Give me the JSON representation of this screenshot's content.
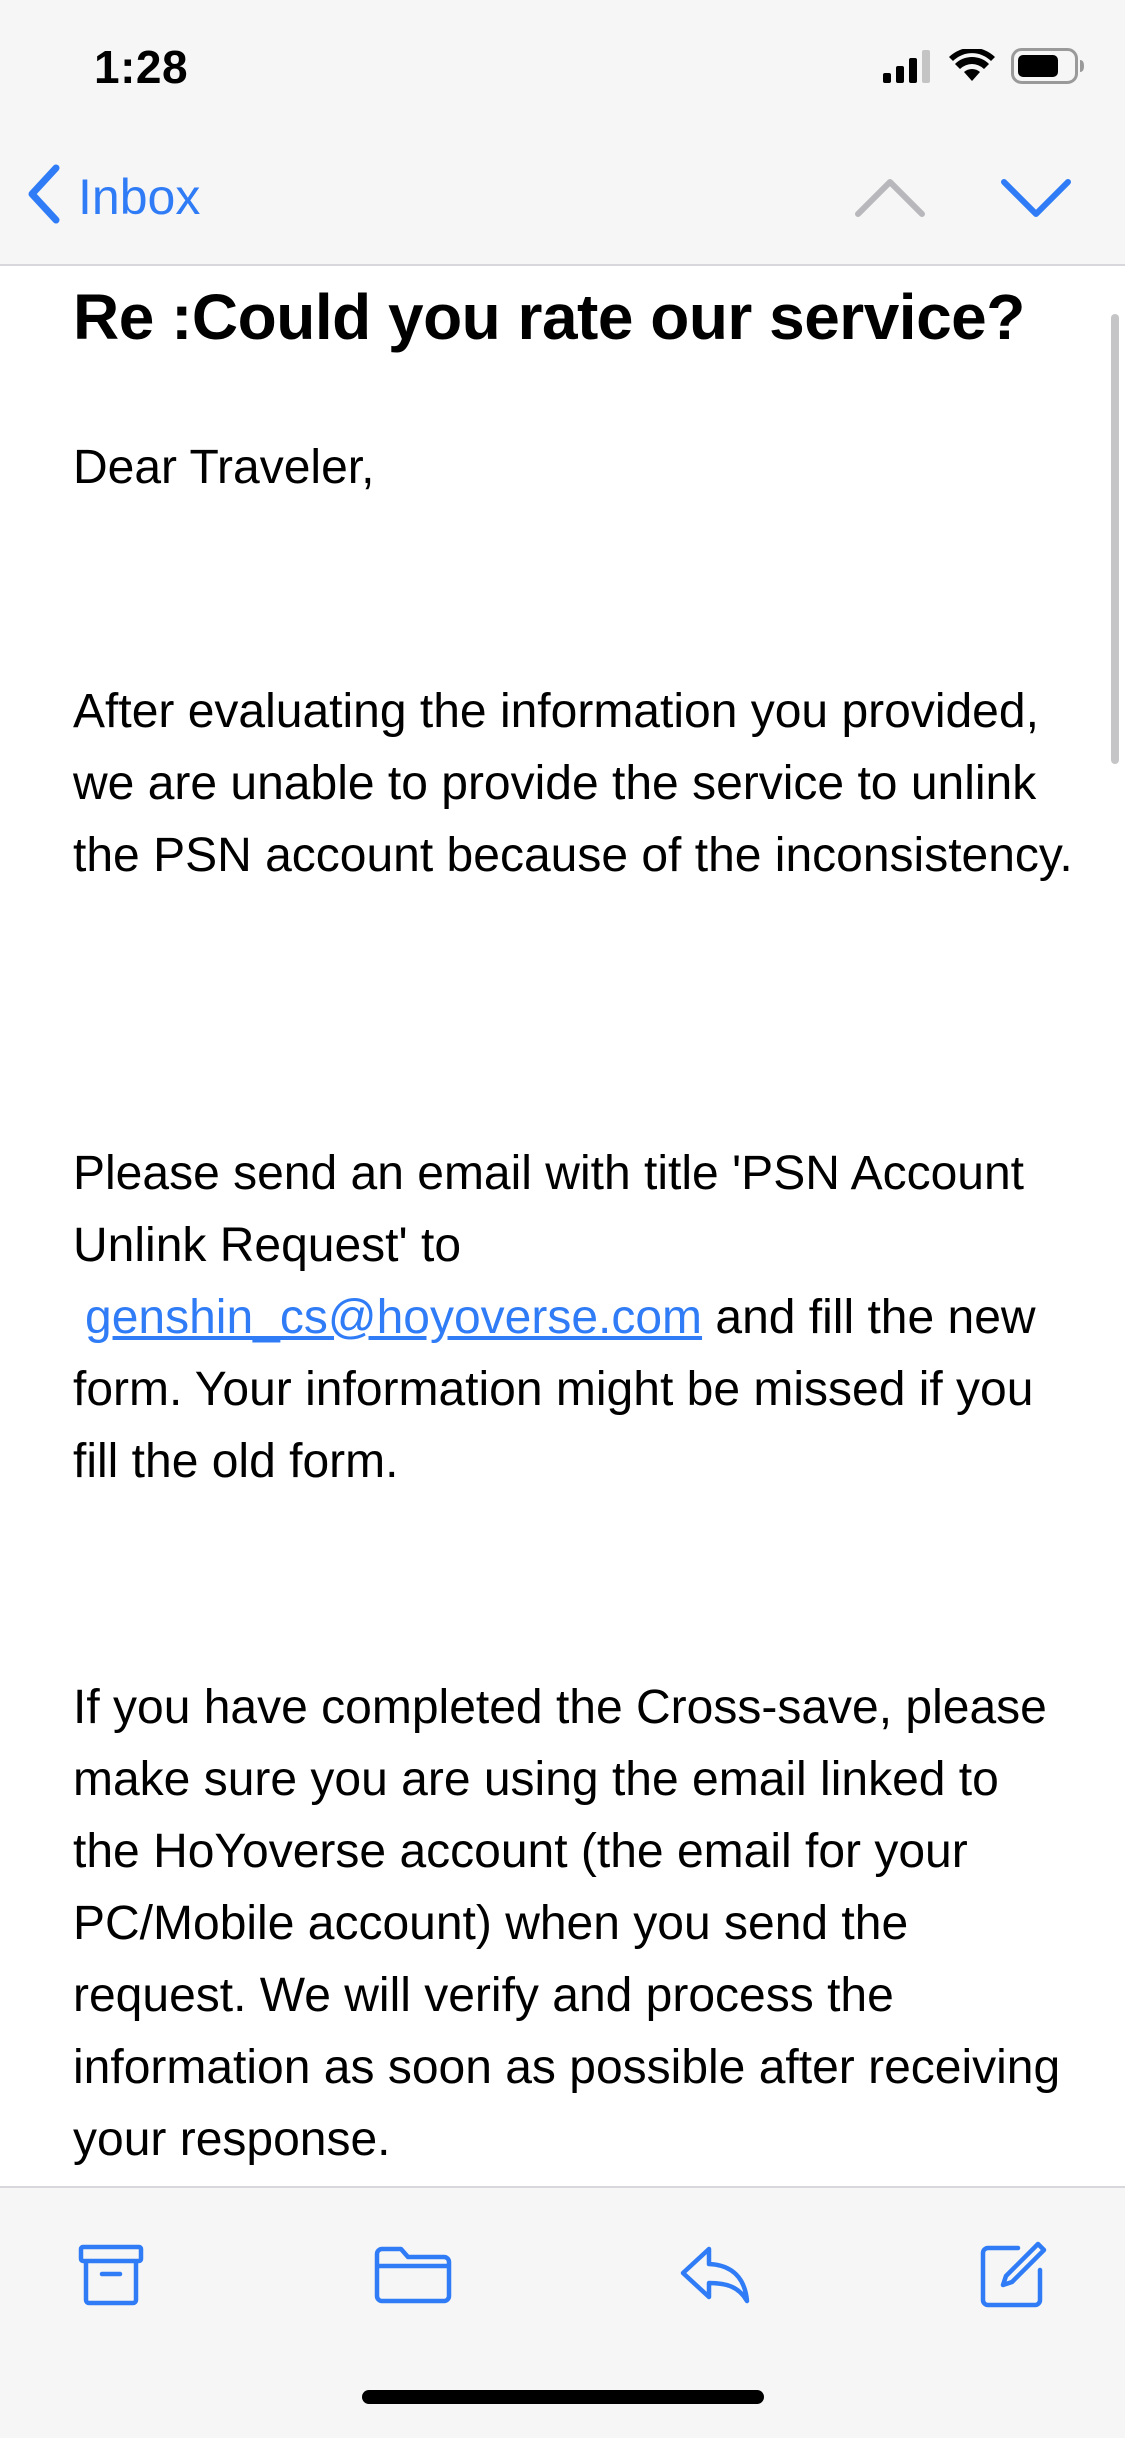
{
  "status_bar": {
    "time": "1:28",
    "icons": [
      "cellular-signal-icon",
      "wifi-icon",
      "battery-icon"
    ]
  },
  "nav": {
    "back_label": "Inbox",
    "icons": [
      "chevron-left-icon",
      "chevron-up-icon",
      "chevron-down-icon"
    ]
  },
  "message": {
    "subject": "Re :Could you rate our service?",
    "greeting": "Dear Traveler,",
    "paragraph_2": "After evaluating the information you provided, we are unable to provide the service to unlink the PSN account because of the inconsistency.",
    "paragraph_3_before": "Please send an email with title 'PSN Account Unlink Request' to",
    "email_link": "genshin_cs@hoyoverse.com",
    "paragraph_3_after": " and fill the new form. Your information might be missed if you fill the old form.",
    "paragraph_4": "If you have completed the Cross-save, please make sure you are using the email linked to the HoYoverse account (the email for your PC/Mobile account) when you send the request. We will verify and process the information as soon as possible after receiving your response."
  },
  "toolbar": {
    "icons": [
      "archive-icon",
      "folder-icon",
      "reply-icon",
      "compose-icon"
    ]
  },
  "colors": {
    "accent": "#2f7cf6",
    "disabled": "#b8b8bc",
    "bar_background": "#f6f6f6"
  }
}
